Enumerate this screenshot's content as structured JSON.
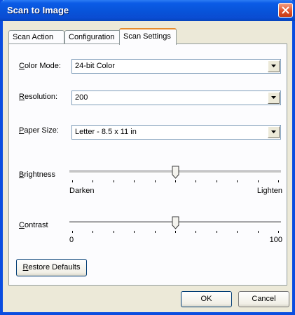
{
  "window": {
    "title": "Scan to Image"
  },
  "tabs": [
    {
      "label": "Scan Action",
      "active": false
    },
    {
      "label": "Configuration",
      "active": false
    },
    {
      "label": "Scan Settings",
      "active": true
    }
  ],
  "color_mode": {
    "label_key": "C",
    "label_rest": "olor Mode:",
    "value": "24-bit Color"
  },
  "resolution": {
    "label_key": "R",
    "label_rest": "esolution:",
    "value": "200"
  },
  "paper_size": {
    "label_key": "P",
    "label_rest": "aper Size:",
    "value": "Letter - 8.5  x 11 in"
  },
  "brightness": {
    "label_key": "B",
    "label_rest": "rightness",
    "min_label": "Darken",
    "max_label": "Lighten",
    "level": 0.5
  },
  "contrast": {
    "label_key": "C",
    "label_rest": "ontrast",
    "min_label": "0",
    "max_label": "100",
    "level": 0.5
  },
  "buttons": {
    "restore_key": "R",
    "restore_rest": "estore Defaults",
    "ok": "OK",
    "cancel": "Cancel"
  }
}
